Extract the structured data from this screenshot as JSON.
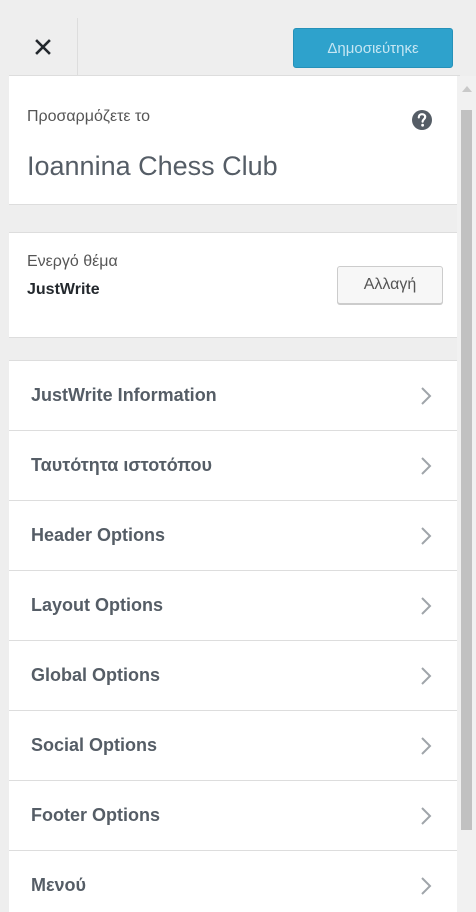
{
  "header": {
    "close_icon": "close-icon",
    "publish_label": "Δημοσιεύτηκε",
    "publish_color": "#2ea2cc"
  },
  "customize_info": {
    "label": "Προσαρμόζετε το",
    "site_title": "Ioannina Chess Club",
    "help_icon": "help-icon"
  },
  "theme": {
    "label": "Ενεργό θέμα",
    "name": "JustWrite",
    "change_label": "Αλλαγή"
  },
  "sections": [
    {
      "label": "JustWrite Information"
    },
    {
      "label": "Ταυτότητα ιστοτόπου"
    },
    {
      "label": "Header Options"
    },
    {
      "label": "Layout Options"
    },
    {
      "label": "Global Options"
    },
    {
      "label": "Social Options"
    },
    {
      "label": "Footer Options"
    },
    {
      "label": "Μενού"
    }
  ]
}
